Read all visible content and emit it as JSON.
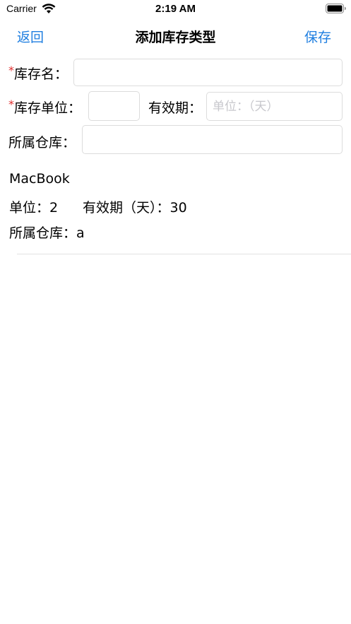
{
  "status_bar": {
    "carrier": "Carrier",
    "time": "2:19 AM",
    "wifi_icon": "wifi-icon",
    "battery_icon": "battery-icon"
  },
  "nav": {
    "back_label": "返回",
    "title": "添加库存类型",
    "save_label": "保存",
    "accent_color": "#1e7ee0"
  },
  "form": {
    "required_mark": "*",
    "required_color": "#e03030",
    "name_label": "库存名：",
    "name_value": "",
    "unit_label": "库存单位：",
    "unit_value": "",
    "expiry_label": "有效期：",
    "expiry_value": "",
    "expiry_placeholder": "单位：（天）",
    "warehouse_label": "所属仓库：",
    "warehouse_value": ""
  },
  "records": [
    {
      "name": "MacBook",
      "unit_text": "单位：2",
      "expiry_text": "有效期（天）：30",
      "warehouse_text": "所属仓库：a"
    }
  ]
}
